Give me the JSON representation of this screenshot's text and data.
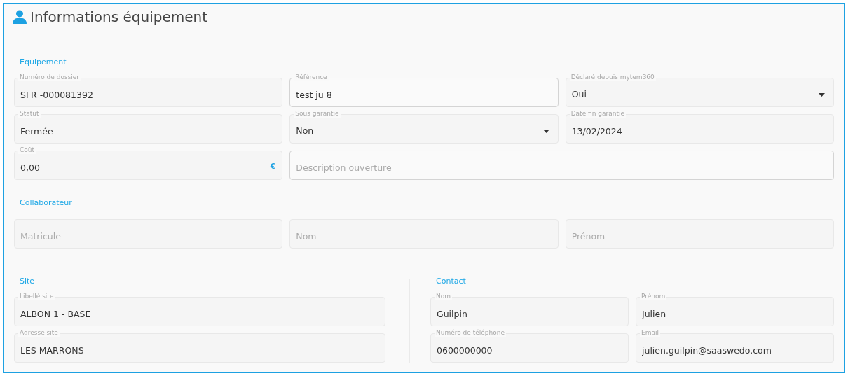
{
  "title": "Informations équipement",
  "equipement": {
    "heading": "Equipement",
    "fields": [
      {
        "kind": "text",
        "label": "Numéro de dossier",
        "value": "SFR -000081392",
        "disabled": true
      },
      {
        "kind": "text",
        "label": "Référence",
        "value": "test ju 8",
        "disabled": false
      },
      {
        "kind": "select",
        "label": "Déclaré depuis mytem360",
        "value": "Oui",
        "disabled": true
      },
      {
        "kind": "text",
        "label": "Statut",
        "value": "Fermée",
        "disabled": true
      },
      {
        "kind": "select",
        "label": "Sous garantie",
        "value": "Non",
        "disabled": true
      },
      {
        "kind": "text",
        "label": "Date fin garantie",
        "value": "13/02/2024",
        "disabled": true
      },
      {
        "kind": "currency",
        "label": "Coût",
        "value": "0,00",
        "suffix": "€",
        "disabled": true
      },
      {
        "kind": "text",
        "placeholder": "Description ouverture",
        "disabled": false,
        "wide": true
      }
    ]
  },
  "collaborateur": {
    "heading": "Collaborateur",
    "fields": [
      {
        "kind": "text",
        "placeholder": "Matricule",
        "disabled": true
      },
      {
        "kind": "text",
        "placeholder": "Nom",
        "disabled": true
      },
      {
        "kind": "text",
        "placeholder": "Prénom",
        "disabled": true
      }
    ]
  },
  "site": {
    "heading": "Site",
    "fields": [
      {
        "kind": "text",
        "label": "Libellé site",
        "value": "ALBON 1 - BASE",
        "disabled": true
      },
      {
        "kind": "text",
        "label": "Adresse site",
        "value": "LES MARRONS",
        "disabled": true
      }
    ]
  },
  "contact": {
    "heading": "Contact",
    "fields": [
      {
        "kind": "text",
        "label": "Nom",
        "value": "Guilpin",
        "disabled": true
      },
      {
        "kind": "text",
        "label": "Prénom",
        "value": "Julien",
        "disabled": true
      },
      {
        "kind": "text",
        "label": "Numéro de téléphone",
        "value": "0600000000",
        "disabled": true
      },
      {
        "kind": "text",
        "label": "Email",
        "value": "julien.guilpin@saaswedo.com",
        "disabled": true
      }
    ]
  }
}
